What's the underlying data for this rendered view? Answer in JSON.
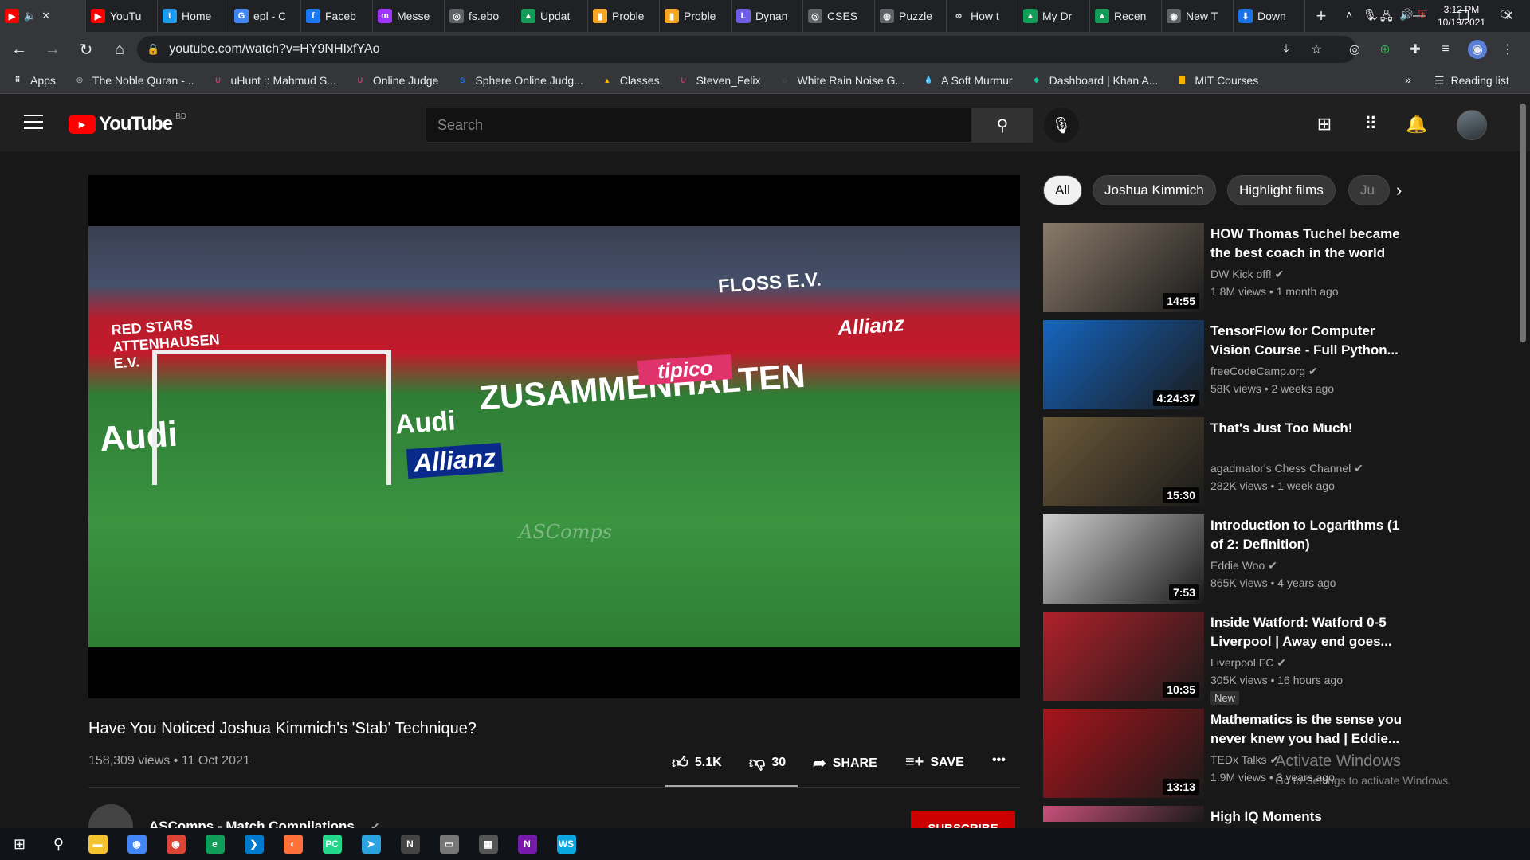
{
  "browser": {
    "tabs": [
      {
        "title": "",
        "favicon": "youtube",
        "color": "#ff0000",
        "glyph": "▶",
        "active": true
      },
      {
        "title": "YouTu",
        "favicon": "youtube",
        "color": "#ff0000",
        "glyph": "▶"
      },
      {
        "title": "Home",
        "favicon": "twitter",
        "color": "#1d9bf0",
        "glyph": "t"
      },
      {
        "title": "epl - C",
        "favicon": "google",
        "color": "#4285f4",
        "glyph": "G"
      },
      {
        "title": "Faceb",
        "favicon": "facebook",
        "color": "#1877f2",
        "glyph": "f"
      },
      {
        "title": "Messe",
        "favicon": "messenger",
        "color": "#a033ff",
        "glyph": "m"
      },
      {
        "title": "fs.ebo",
        "favicon": "globe",
        "color": "#5f6368",
        "glyph": "◎"
      },
      {
        "title": "Updat",
        "favicon": "drive",
        "color": "#0f9d58",
        "glyph": "▲"
      },
      {
        "title": "Proble",
        "favicon": "chart",
        "color": "#f5a623",
        "glyph": "▮"
      },
      {
        "title": "Proble",
        "favicon": "chart",
        "color": "#f5a623",
        "glyph": "▮"
      },
      {
        "title": "Dynan",
        "favicon": "lightoj",
        "color": "#6c5ce7",
        "glyph": "L"
      },
      {
        "title": "CSES",
        "favicon": "globe",
        "color": "#5f6368",
        "glyph": "◎"
      },
      {
        "title": "Puzzle",
        "favicon": "puzzle",
        "color": "#5f6368",
        "glyph": "◍"
      },
      {
        "title": "How t",
        "favicon": "infinity",
        "color": "#202124",
        "glyph": "∞"
      },
      {
        "title": "My Dr",
        "favicon": "drive",
        "color": "#0f9d58",
        "glyph": "▲"
      },
      {
        "title": "Recen",
        "favicon": "drive",
        "color": "#0f9d58",
        "glyph": "▲"
      },
      {
        "title": "New T",
        "favicon": "chrome",
        "color": "#5f6368",
        "glyph": "◉"
      },
      {
        "title": "Down",
        "favicon": "download",
        "color": "#1a73e8",
        "glyph": "⬇"
      }
    ],
    "url": "youtube.com/watch?v=HY9NHIxfYAo",
    "bookmarks": [
      {
        "label": "Apps",
        "glyph": "⠿",
        "color": "#e8eaed"
      },
      {
        "label": "The Noble Quran -...",
        "glyph": "◎",
        "color": "#9aa0a6"
      },
      {
        "label": "uHunt :: Mahmud S...",
        "glyph": "U",
        "color": "#d6336c"
      },
      {
        "label": "Online Judge",
        "glyph": "U",
        "color": "#d6336c"
      },
      {
        "label": "Sphere Online Judg...",
        "glyph": "S",
        "color": "#1a73e8"
      },
      {
        "label": "Classes",
        "glyph": "▲",
        "color": "#f4b400"
      },
      {
        "label": "Steven_Felix",
        "glyph": "U",
        "color": "#d6336c"
      },
      {
        "label": "White Rain Noise G...",
        "glyph": "◌",
        "color": "#9aa0a6"
      },
      {
        "label": "A Soft Murmur",
        "glyph": "💧",
        "color": "#4fc3f7"
      },
      {
        "label": "Dashboard | Khan A...",
        "glyph": "◆",
        "color": "#14bf96"
      },
      {
        "label": "MIT Courses",
        "glyph": "▇",
        "color": "#f4b400"
      }
    ],
    "bookmarks_more": "»",
    "reading_list": "Reading list"
  },
  "youtube": {
    "logo_text": "YouTube",
    "country_code": "BD",
    "search_placeholder": "Search",
    "chips": [
      "All",
      "Joshua Kimmich",
      "Highlight films",
      "Ju"
    ],
    "video": {
      "title": "Have You Noticed Joshua Kimmich's 'Stab' Technique?",
      "meta": "158,309 views • 11 Oct 2021",
      "likes": "5.1K",
      "dislikes": "30",
      "share": "SHARE",
      "save": "SAVE",
      "more": "•••",
      "watermark": "ASComps",
      "banners": [
        "ZUSAMMENHALTEN",
        "Audi",
        "Allianz",
        "tipico",
        "FLOSS E.V.",
        "RED STARS ATTENHAUSEN E.V."
      ]
    },
    "channel": {
      "name": "ASComps - Match Compilations",
      "subscribe": "SUBSCRIBE"
    },
    "recommendations": [
      {
        "title": "HOW Thomas Tuchel became the best coach in the world",
        "channel": "DW Kick off!",
        "views": "1.8M views • 1 month ago",
        "duration": "14:55",
        "thumb": "#8a7a6a",
        "badge": ""
      },
      {
        "title": "TensorFlow for Computer Vision Course - Full Python...",
        "channel": "freeCodeCamp.org",
        "views": "58K views • 2 weeks ago",
        "duration": "4:24:37",
        "thumb": "#1565c0",
        "badge": ""
      },
      {
        "title": "That's Just Too Much!",
        "channel": "agadmator's Chess Channel",
        "views": "282K views • 1 week ago",
        "duration": "15:30",
        "thumb": "#6d5a3a",
        "badge": ""
      },
      {
        "title": "Introduction to Logarithms (1 of 2: Definition)",
        "channel": "Eddie Woo",
        "views": "865K views • 4 years ago",
        "duration": "7:53",
        "thumb": "#cfcfcf",
        "badge": ""
      },
      {
        "title": "Inside Watford: Watford 0-5 Liverpool | Away end goes...",
        "channel": "Liverpool FC",
        "views": "305K views • 16 hours ago",
        "duration": "10:35",
        "thumb": "#b0202a",
        "badge": "New"
      },
      {
        "title": "Mathematics is the sense you never knew you had | Eddie...",
        "channel": "TEDx Talks",
        "views": "1.9M views • 3 years ago",
        "duration": "13:13",
        "thumb": "#a8141c",
        "badge": ""
      },
      {
        "title": "High IQ Moments",
        "channel": "",
        "views": "",
        "duration": "",
        "thumb": "#c8507a",
        "badge": ""
      }
    ]
  },
  "os": {
    "watermark_title": "Activate Windows",
    "watermark_sub": "Go to Settings to activate Windows.",
    "time": "3:12 PM",
    "date": "10/19/2021",
    "taskbar_apps": [
      {
        "name": "file-explorer",
        "glyph": "▬",
        "color": "#f4c430"
      },
      {
        "name": "chrome",
        "glyph": "◉",
        "color": "#4285f4"
      },
      {
        "name": "chrome-alt",
        "glyph": "◉",
        "color": "#db4437"
      },
      {
        "name": "edge",
        "glyph": "e",
        "color": "#0f9d58"
      },
      {
        "name": "vscode",
        "glyph": "❯",
        "color": "#007acc"
      },
      {
        "name": "firefox",
        "glyph": "◐",
        "color": "#ff7139"
      },
      {
        "name": "pycharm",
        "glyph": "PC",
        "color": "#21d789"
      },
      {
        "name": "telegram",
        "glyph": "➤",
        "color": "#2aa3df"
      },
      {
        "name": "notion",
        "glyph": "N",
        "color": "#444"
      },
      {
        "name": "terminal",
        "glyph": "▭",
        "color": "#777"
      },
      {
        "name": "calculator",
        "glyph": "▦",
        "color": "#555"
      },
      {
        "name": "onenote",
        "glyph": "N",
        "color": "#7719aa"
      },
      {
        "name": "webstorm",
        "glyph": "WS",
        "color": "#0aa8e0"
      }
    ]
  }
}
